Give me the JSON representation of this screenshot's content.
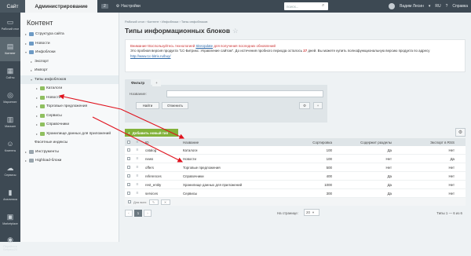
{
  "topbar": {
    "site_label": "Сайт",
    "admin_label": "Администрирование",
    "notif_count": "2",
    "settings_label": "Настройки",
    "search_placeholder": "поиск...",
    "user_name": "Вадим Лесин",
    "lang": "RU",
    "help_label": "Справка"
  },
  "iconbar": [
    {
      "label": "Рабочий стол",
      "icon": "desktop-icon"
    },
    {
      "label": "Контент",
      "icon": "content-icon"
    },
    {
      "label": "Сайты",
      "icon": "sites-icon"
    },
    {
      "label": "Маркетинг",
      "icon": "marketing-icon"
    },
    {
      "label": "Магазин",
      "icon": "shop-icon"
    },
    {
      "label": "Клиенты",
      "icon": "clients-icon"
    },
    {
      "label": "Сервисы",
      "icon": "services-icon"
    },
    {
      "label": "Аналитика",
      "icon": "analytics-icon"
    },
    {
      "label": "Marketplace",
      "icon": "marketplace-icon"
    },
    {
      "label": "Перейти в Битрикс24",
      "icon": "bitrix24-icon"
    }
  ],
  "tree": {
    "title": "Контент",
    "items": [
      "Структура сайта",
      "Новости",
      "Инфоблоки",
      "Экспорт",
      "Импорт",
      "Типы инфоблоков",
      "Каталоги",
      "Новости",
      "Торговые предложения",
      "Сервисы",
      "Справочники",
      "Хранилище данных для приложений",
      "Фасетные индексы",
      "Инструменты",
      "Highload-блоки"
    ]
  },
  "main": {
    "breadcrumbs": "Рабочий стол  ›  Контент  ›  Инфоблоки  ›  Типы инфоблоков",
    "title": "Типы информационных блоков",
    "warning": {
      "line1_a": "Внимание! Воспользуйтесь технологией ",
      "line1_link": "SiteUpdate",
      "line1_b": " для получения последних обновлений",
      "line2_a": "Это пробная версия продукта \"1С-Битрикс: Управление сайтом\". До истечения пробного периода осталось ",
      "line2_num": "27",
      "line2_b": " дней. Вы можете купить полнофункциональную версию продукта по адресу",
      "line3_link": "http://www.1c-bitrix.ru/buy/"
    },
    "filter": {
      "tab": "Фильтр",
      "plus": "+",
      "name_label": "Название:",
      "find": "Найти",
      "cancel": "Отменить"
    },
    "add_button": "Добавить новый тип",
    "columns": [
      "ID",
      "Название",
      "Сортировка",
      "Содержит разделы",
      "Экспорт в RSS"
    ],
    "rows": [
      [
        "catalog",
        "Каталоги",
        "100",
        "Да",
        "Нет"
      ],
      [
        "news",
        "Новости",
        "100",
        "Нет",
        "Да"
      ],
      [
        "offers",
        "Торговые предложения",
        "500",
        "Нет",
        "Нет"
      ],
      [
        "references",
        "Справочники",
        "400",
        "Да",
        "Нет"
      ],
      [
        "rest_entity",
        "Хранилище данных для приложений",
        "1000",
        "Да",
        "Нет"
      ],
      [
        "services",
        "Сервисы",
        "300",
        "Да",
        "Нет"
      ]
    ],
    "footer_label": "Для всех",
    "pager": {
      "current": "1",
      "per_page_label": "На странице:",
      "per_page": "20",
      "total": "Типы 1 — 6 из 6"
    }
  },
  "colors": {
    "dark_panel": "#3d4953",
    "accent_green": "#82b23a",
    "arrow_red": "#e0121d"
  }
}
